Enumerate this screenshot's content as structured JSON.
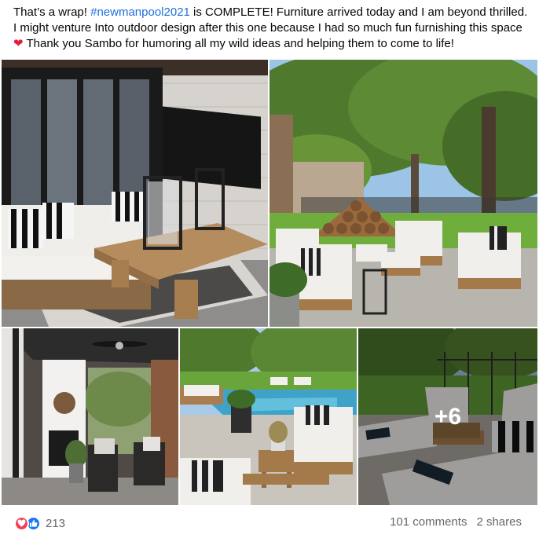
{
  "post": {
    "text_before": "That’s a wrap! ",
    "hashtag": "#newmanpool2021",
    "text_middle": " is COMPLETE! Furniture arrived today and I am beyond thrilled. I might venture Into outdoor design after this one because I had so much fun furnishing this space ",
    "heart": "❤",
    "text_after": " Thank you Sambo for humoring all my wild ideas and helping them to come to life!"
  },
  "photos": {
    "more_count": "+6"
  },
  "footer": {
    "reaction_count": "213",
    "comments": "101 comments",
    "shares": "2 shares"
  },
  "colors": {
    "hashtag": "#216fdb",
    "love": "#f33e58",
    "like": "#1877f2",
    "meta_text": "#65676b"
  }
}
